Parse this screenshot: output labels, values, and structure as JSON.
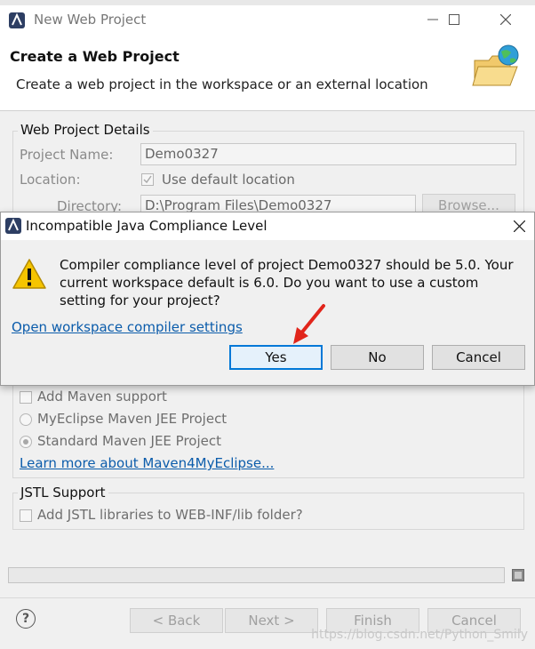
{
  "window": {
    "title": "New Web Project",
    "header_title": "Create a Web Project",
    "header_subtitle": "Create a web project in the workspace or an external location"
  },
  "details": {
    "group_title": "Web Project Details",
    "project_name_label": "Project Name:",
    "project_name_value": "Demo0327",
    "location_label": "Location:",
    "use_default_label": "Use default location",
    "directory_label": "Directory:",
    "directory_value": "D:\\Program Files\\Demo0327",
    "browse_label": "Browse..."
  },
  "maven": {
    "add_maven_label": "Add Maven support",
    "myeclipse_jee_label": "MyEclipse Maven JEE Project",
    "standard_jee_label": "Standard Maven JEE Project",
    "learn_more_link": "Learn more about Maven4MyEclipse..."
  },
  "jstl": {
    "group_title": "JSTL Support",
    "add_jstl_label": "Add JSTL libraries to WEB-INF/lib folder?"
  },
  "footer": {
    "back_label": "< Back",
    "next_label": "Next >",
    "finish_label": "Finish",
    "cancel_label": "Cancel",
    "help_glyph": "?"
  },
  "dialog": {
    "title": "Incompatible Java Compliance Level",
    "message": "Compiler compliance level of project Demo0327 should be 5.0. Your current workspace default is 6.0. Do you want to use a custom setting for your project?",
    "link": "Open workspace compiler settings",
    "yes_label": "Yes",
    "no_label": "No",
    "cancel_label": "Cancel",
    "close_glyph": "✕"
  },
  "watermark": "https://blog.csdn.net/Python_Smily",
  "colors": {
    "accent": "#0078d7",
    "link": "#0b5cab",
    "warning_yellow": "#f5c400",
    "arrow_red": "#e1251b"
  }
}
